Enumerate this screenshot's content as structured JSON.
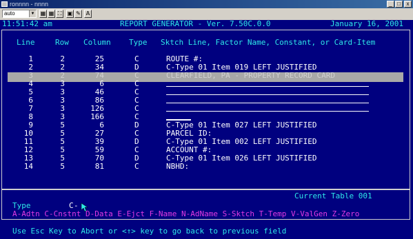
{
  "window": {
    "title": "ronnnn - nnnn",
    "buttons": [
      "_",
      "□",
      "x"
    ]
  },
  "toolbar": {
    "font_select": "auto",
    "buttons": [
      "▦",
      "▦",
      "⛶",
      "▣",
      "✎",
      "A"
    ]
  },
  "header": {
    "time": "11:51:42 am",
    "title": "REPORT GENERATOR - Ver. 7.50C.0.0",
    "date": "January 16, 2001"
  },
  "columns": [
    "Line",
    "Row",
    "Column",
    "Type",
    "Sktch Line, Factor Name, Constant, or Card-Item"
  ],
  "rows": [
    {
      "line": "1",
      "row": "2",
      "col": "25",
      "type": "C",
      "text": "ROUTE #:"
    },
    {
      "line": "2",
      "row": "2",
      "col": "34",
      "type": "D",
      "text": "C-Type 01 Item 019 LEFT JUSTIFIED"
    },
    {
      "line": "3",
      "row": "2",
      "col": "74",
      "type": "C",
      "text": "CLEARFIELD, PA - PROPERTY RECORD CARD"
    },
    {
      "line": "4",
      "row": "3",
      "col": "6",
      "type": "C",
      "text": ""
    },
    {
      "line": "5",
      "row": "3",
      "col": "46",
      "type": "C",
      "text": ""
    },
    {
      "line": "6",
      "row": "3",
      "col": "86",
      "type": "C",
      "text": ""
    },
    {
      "line": "7",
      "row": "3",
      "col": "126",
      "type": "C",
      "text": ""
    },
    {
      "line": "8",
      "row": "3",
      "col": "166",
      "type": "C",
      "text": ""
    },
    {
      "line": "9",
      "row": "5",
      "col": "6",
      "type": "D",
      "text": "C-Type 01 Item 027 LEFT JUSTIFIED"
    },
    {
      "line": "10",
      "row": "5",
      "col": "27",
      "type": "C",
      "text": "PARCEL ID:"
    },
    {
      "line": "11",
      "row": "5",
      "col": "39",
      "type": "D",
      "text": "C-Type 01 Item 002 LEFT JUSTIFIED"
    },
    {
      "line": "12",
      "row": "5",
      "col": "59",
      "type": "C",
      "text": "ACCOUNT #:"
    },
    {
      "line": "13",
      "row": "5",
      "col": "70",
      "type": "D",
      "text": "C-Type 01 Item 026 LEFT JUSTIFIED"
    },
    {
      "line": "14",
      "row": "5",
      "col": "81",
      "type": "C",
      "text": "NBHD:"
    }
  ],
  "current_table": "Current Table 001",
  "type_prompt": {
    "label": "Type",
    "value": "C"
  },
  "type_options": "A-Adtn C-Cnstnt D-Data E-Ejct F-Name N-AdName S-Sktch T-Temp V-ValGen Z-Zero",
  "status": "Use Esc Key to Abort or <↑> key to go back to previous field",
  "colors": {
    "background": "#00007f",
    "cyan": "#2ee8e8",
    "magenta": "#e23ae2",
    "highlight": "#a8a8a8"
  }
}
